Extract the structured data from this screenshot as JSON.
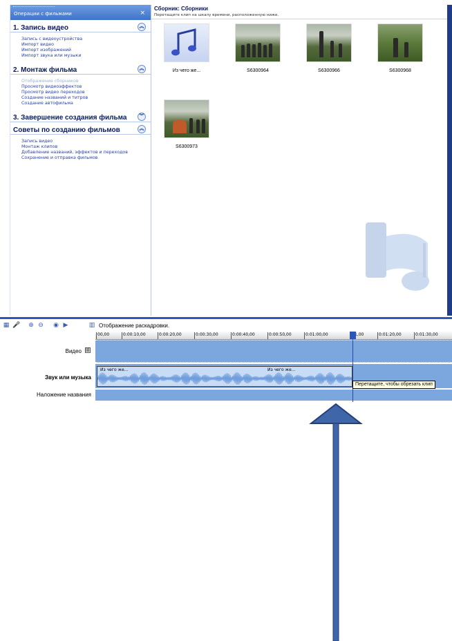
{
  "task_pane": {
    "header_title": "Операции с фильмами",
    "close_symbol": "×",
    "sections": [
      {
        "title": "1. Запись видео",
        "chevron": "up",
        "links": [
          {
            "label": "Запись с видеоустройства",
            "disabled": false
          },
          {
            "label": "Импорт видео",
            "disabled": false
          },
          {
            "label": "Импорт изображений",
            "disabled": false
          },
          {
            "label": "Импорт звука или музыки",
            "disabled": false
          }
        ]
      },
      {
        "title": "2. Монтаж фильма",
        "chevron": "up",
        "links": [
          {
            "label": "Отображение сборников",
            "disabled": true
          },
          {
            "label": "Просмотр видеоэффектов",
            "disabled": false
          },
          {
            "label": "Просмотр видео переходов",
            "disabled": false
          },
          {
            "label": "Создание названий и титров",
            "disabled": false
          },
          {
            "label": "Создание автофильма",
            "disabled": false
          }
        ]
      },
      {
        "title": "3. Завершение создания фильма",
        "chevron": "down",
        "links": []
      },
      {
        "title": "Советы по созданию фильмов",
        "chevron": "up",
        "links": [
          {
            "label": "Запись видео",
            "disabled": false
          },
          {
            "label": "Монтаж клипов",
            "disabled": false
          },
          {
            "label": "Добавление названий, эффектов и переходов",
            "disabled": false
          },
          {
            "label": "Сохранение и отправка фильмов",
            "disabled": false
          }
        ]
      }
    ]
  },
  "collection": {
    "title": "Сборник: Сборники",
    "subtitle": "Перетащите клип на шкалу времени, расположенную ниже.",
    "clips": [
      {
        "caption": "Из чего же...",
        "kind": "music-icon"
      },
      {
        "caption": "S6300964",
        "kind": "photo"
      },
      {
        "caption": "S6300966",
        "kind": "photo"
      },
      {
        "caption": "S6300968",
        "kind": "photo"
      },
      {
        "caption": "S6300973",
        "kind": "photo"
      }
    ]
  },
  "timeline": {
    "toolbar_icons": [
      "storyboard-toggle-icon",
      "narrate-icon",
      "zoom-in-icon",
      "zoom-out-icon",
      "rewind-icon",
      "play-icon",
      "storyboard-icon"
    ],
    "storyboard_label": "Отображение раскадровки.",
    "ruler_ticks": [
      "00,00",
      "0:00:10,00",
      "0:00:20,00",
      "0:00:30,00",
      "0:00:40,00",
      "0:00:50,00",
      "0:01:00,00",
      "1,00",
      "0:01:20,00",
      "0:01:30,00"
    ],
    "track_labels": {
      "video": "Видео",
      "audio": "Звук или музыка",
      "title": "Наложение названия"
    },
    "expand_symbol": "⊞",
    "audio_clip_labels": [
      "Из чего же...",
      "Из чего же..."
    ],
    "tooltip": "Перетащите, чтобы обрезать клип"
  },
  "colors": {
    "track_blue": "#7ba7de",
    "arrow_blue": "#3f66a8",
    "header_blue": "#3f73c9"
  }
}
